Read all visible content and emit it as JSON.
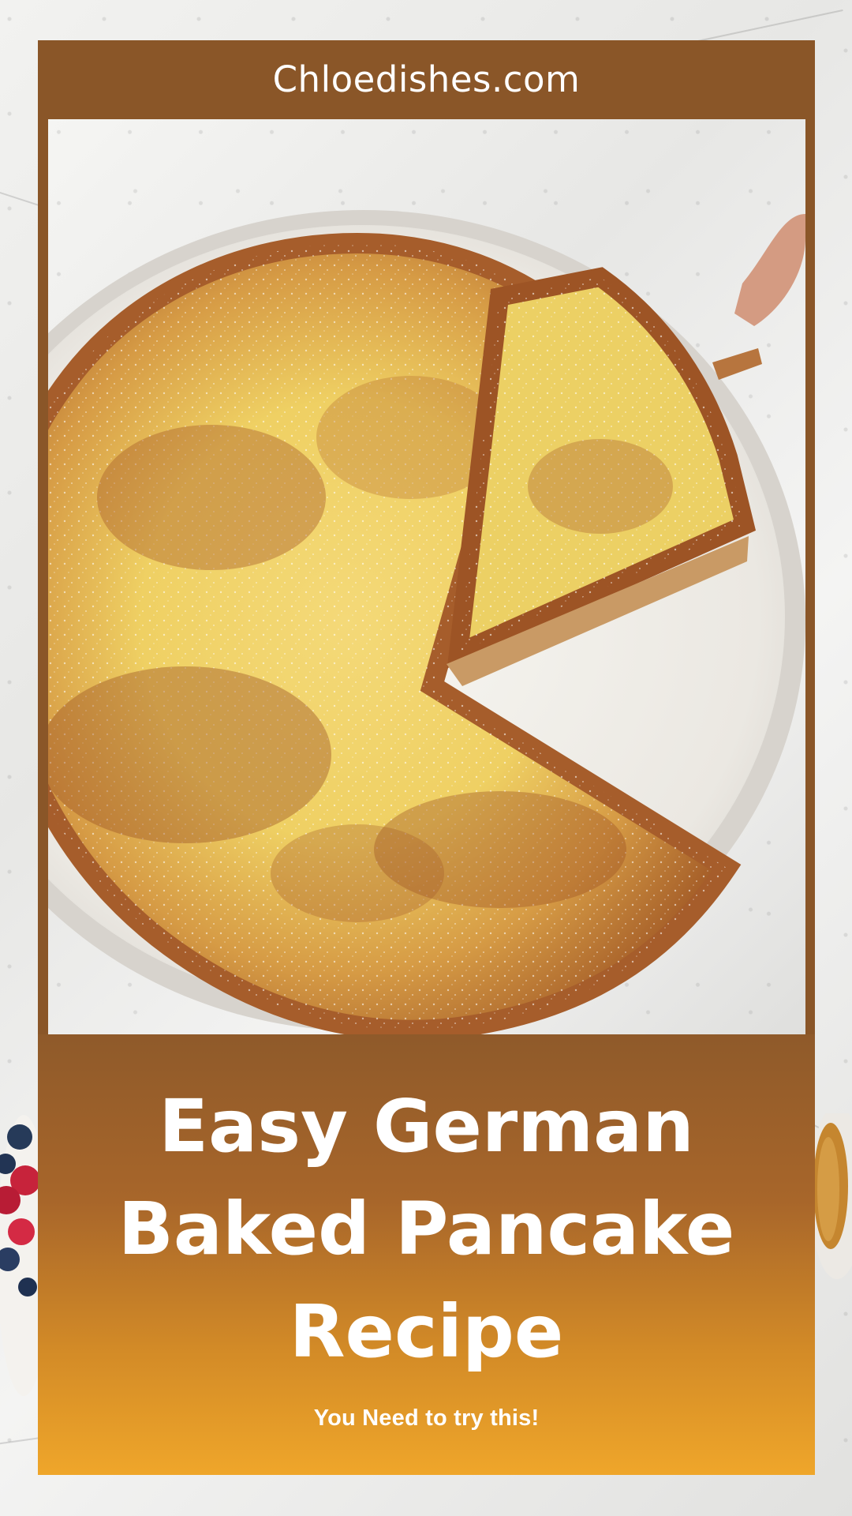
{
  "site": {
    "domain": "Chloedishes.com"
  },
  "recipe": {
    "title": "Easy German Baked Pancake Recipe",
    "subtitle": "You Need to try this!"
  },
  "colors": {
    "header_brown": "#8a5628",
    "panel_top": "#8f5a2a",
    "panel_bottom": "#efa62a",
    "text": "#ffffff"
  },
  "image": {
    "subject_icon": "baked-pancake-photo"
  }
}
